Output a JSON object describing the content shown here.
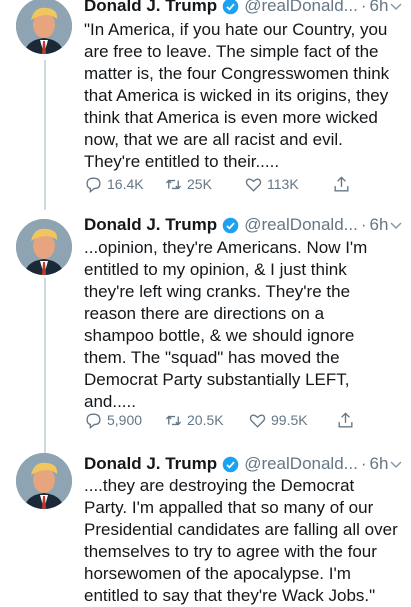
{
  "tweets": [
    {
      "author_name": "Donald J. Trump",
      "handle": "@realDonald...",
      "time": "6h",
      "text_lines": [
        "\"In America, if you hate our Country, you",
        "are free to leave. The simple fact of the",
        "matter is, the four Congresswomen think",
        "that America is wicked in its origins, they",
        "think that America is even more wicked",
        "now, that we are all racist and evil.",
        "They're entitled to their....."
      ],
      "replies": "16.4K",
      "retweets": "25K",
      "likes": "113K"
    },
    {
      "author_name": "Donald J. Trump",
      "handle": "@realDonald...",
      "time": "6h",
      "text_lines": [
        "...opinion, they're Americans. Now I'm",
        "entitled to my opinion, & I just think",
        "they're left wing cranks. They're the",
        "reason there are directions on a",
        "shampoo bottle, & we should ignore",
        "them. The \"squad\" has moved the",
        "Democrat Party substantially LEFT,",
        "and....."
      ],
      "replies": "5,900",
      "retweets": "20.5K",
      "likes": "99.5K"
    },
    {
      "author_name": "Donald J. Trump",
      "handle": "@realDonald...",
      "time": "6h",
      "text_lines": [
        "....they are destroying the Democrat",
        "Party. I'm appalled that so many of our",
        "Presidential candidates are falling all over",
        "themselves to try to agree with the four",
        "horsewomen of the apocalypse. I'm",
        "entitled to say that they're Wack Jobs.\""
      ]
    }
  ],
  "separator": "·",
  "icons": {
    "verified": "verified-badge-icon",
    "menu": "chevron-down-icon",
    "reply": "reply-icon",
    "retweet": "retweet-icon",
    "like": "heart-icon",
    "share": "share-icon"
  },
  "colors": {
    "text": "#14171a",
    "secondary": "#657786",
    "verified": "#1da1f2",
    "thread_line": "#cfd9de"
  }
}
